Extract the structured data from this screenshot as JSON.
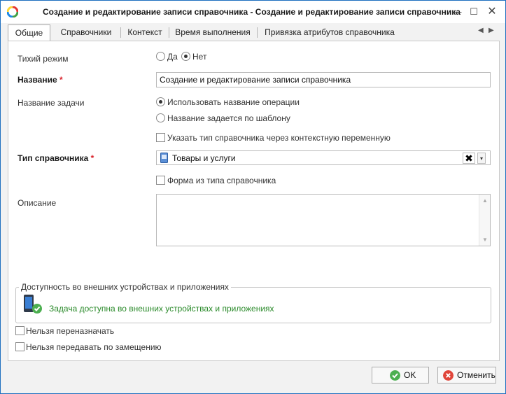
{
  "window": {
    "title": "Создание и редактирование записи справочника - Создание и редактирование записи справочника",
    "controls": {
      "minimize": "—",
      "maximize": "☐",
      "close": "✕"
    }
  },
  "tabs": [
    {
      "label": "Общие",
      "active": true
    },
    {
      "label": "Справочники",
      "active": false
    },
    {
      "label": "Контекст",
      "active": false
    },
    {
      "label": "Время выполнения",
      "active": false
    },
    {
      "label": "Привязка атрибутов справочника",
      "active": false
    }
  ],
  "tab_nav": {
    "prev": "◀",
    "next": "▶"
  },
  "form": {
    "quiet_mode": {
      "label": "Тихий режим",
      "options": [
        "Да",
        "Нет"
      ],
      "selected": "Нет"
    },
    "name": {
      "label": "Название",
      "required_mark": "*",
      "value": "Создание и редактирование записи справочника"
    },
    "task_name": {
      "label": "Название задачи",
      "options": [
        "Использовать название операции",
        "Название задается по шаблону"
      ],
      "selected": "Использовать название операции"
    },
    "context_var_check": {
      "label": "Указать тип справочника через контекстную переменную",
      "checked": false
    },
    "directory_type": {
      "label": "Тип справочника",
      "required_mark": "*",
      "value": "Товары и услуги",
      "clear_icon": "✖",
      "dropdown_icon": "▾"
    },
    "form_from_type": {
      "label": "Форма из типа справочника",
      "checked": false
    },
    "description": {
      "label": "Описание",
      "value": ""
    },
    "availability": {
      "caption": "Доступность во внешних устройствах и приложениях",
      "status": "Задача доступна во внешних устройствах и приложениях",
      "status_color": "#2a8a2a"
    },
    "no_reassign": {
      "label": "Нельзя переназначать",
      "checked": false
    },
    "no_delegate": {
      "label": "Нельзя передавать по замещению",
      "checked": false
    }
  },
  "buttons": {
    "ok": "OK",
    "cancel": "Отменить"
  },
  "colors": {
    "accent": "#1e6fbf",
    "required": "#d9242c",
    "ok_icon": "#4caf50",
    "cancel_icon": "#e0453a"
  }
}
